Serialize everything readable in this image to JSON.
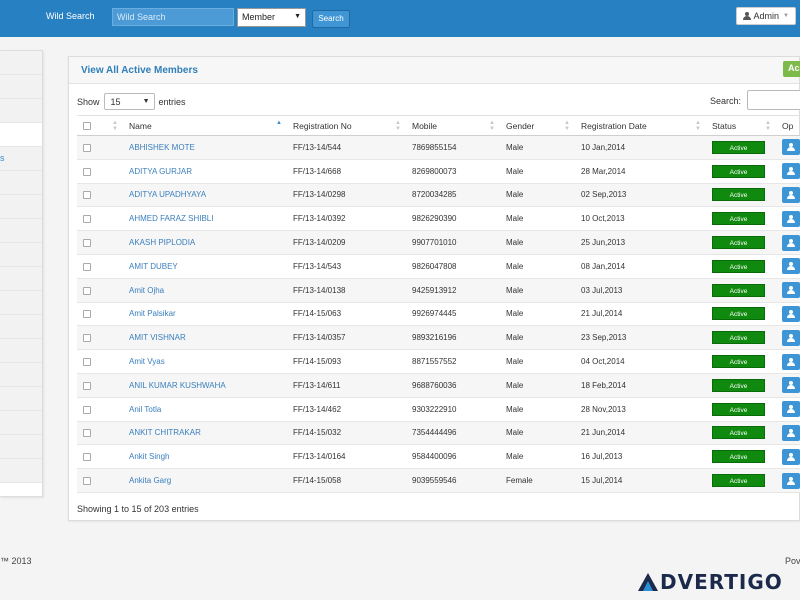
{
  "topbar": {
    "wild_label": "Wild Search",
    "wild_placeholder": "Wild Search",
    "member_select": "Member",
    "search_button": "Search",
    "admin_button": "Admin"
  },
  "panel": {
    "title": "View All Active Members",
    "add_button": "Ac",
    "show_label": "Show",
    "page_length": "15",
    "entries_label": "entries",
    "search_label": "Search:"
  },
  "table": {
    "headers": [
      "Name",
      "Registration No",
      "Mobile",
      "Gender",
      "Registration Date",
      "Status",
      "Op"
    ],
    "rows": [
      {
        "name": "ABHISHEK MOTE",
        "reg": "FF/13-14/544",
        "mobile": "7869855154",
        "gender": "Male",
        "date": "10 Jan,2014",
        "status": "Active"
      },
      {
        "name": "ADITYA GURJAR",
        "reg": "FF/13-14/668",
        "mobile": "8269800073",
        "gender": "Male",
        "date": "28 Mar,2014",
        "status": "Active"
      },
      {
        "name": "ADITYA UPADHYAYA",
        "reg": "FF/13-14/0298",
        "mobile": "8720034285",
        "gender": "Male",
        "date": "02 Sep,2013",
        "status": "Active"
      },
      {
        "name": "AHMED FARAZ SHIBLI",
        "reg": "FF/13-14/0392",
        "mobile": "9826290390",
        "gender": "Male",
        "date": "10 Oct,2013",
        "status": "Active"
      },
      {
        "name": "AKASH PIPLODIA",
        "reg": "FF/13-14/0209",
        "mobile": "9907701010",
        "gender": "Male",
        "date": "25 Jun,2013",
        "status": "Active"
      },
      {
        "name": "AMIT DUBEY",
        "reg": "FF/13-14/543",
        "mobile": "9826047808",
        "gender": "Male",
        "date": "08 Jan,2014",
        "status": "Active"
      },
      {
        "name": "Amit Ojha",
        "reg": "FF/13-14/0138",
        "mobile": "9425913912",
        "gender": "Male",
        "date": "03 Jul,2013",
        "status": "Active"
      },
      {
        "name": "Amit Palsikar",
        "reg": "FF/14-15/063",
        "mobile": "9926974445",
        "gender": "Male",
        "date": "21 Jul,2014",
        "status": "Active"
      },
      {
        "name": "AMIT VISHNAR",
        "reg": "FF/13-14/0357",
        "mobile": "9893216196",
        "gender": "Male",
        "date": "23 Sep,2013",
        "status": "Active"
      },
      {
        "name": "Amit Vyas",
        "reg": "FF/14-15/093",
        "mobile": "8871557552",
        "gender": "Male",
        "date": "04 Oct,2014",
        "status": "Active"
      },
      {
        "name": "ANIL KUMAR KUSHWAHA",
        "reg": "FF/13-14/611",
        "mobile": "9688760036",
        "gender": "Male",
        "date": "18 Feb,2014",
        "status": "Active"
      },
      {
        "name": "Anil Totla",
        "reg": "FF/13-14/462",
        "mobile": "9303222910",
        "gender": "Male",
        "date": "28 Nov,2013",
        "status": "Active"
      },
      {
        "name": "ANKIT CHITRAKAR",
        "reg": "FF/14-15/032",
        "mobile": "7354444496",
        "gender": "Male",
        "date": "21 Jun,2014",
        "status": "Active"
      },
      {
        "name": "Ankit Singh",
        "reg": "FF/13-14/0164",
        "mobile": "9584400096",
        "gender": "Male",
        "date": "16 Jul,2013",
        "status": "Active"
      },
      {
        "name": "Ankita Garg",
        "reg": "FF/14-15/058",
        "mobile": "9039559546",
        "gender": "Female",
        "date": "15 Jul,2014",
        "status": "Active"
      }
    ]
  },
  "showing_text": "Showing 1 to 15 of 203 entries",
  "sidebar": {
    "partial_label": "s"
  },
  "footer": {
    "left": "™ 2013",
    "right": "Pov"
  },
  "watermark": {
    "text": "DVERTIGO"
  },
  "colors": {
    "topbar": "#2680c2",
    "status_active": "#0f8a0f",
    "link": "#3a7fbd",
    "op_button": "#3d95d6"
  }
}
